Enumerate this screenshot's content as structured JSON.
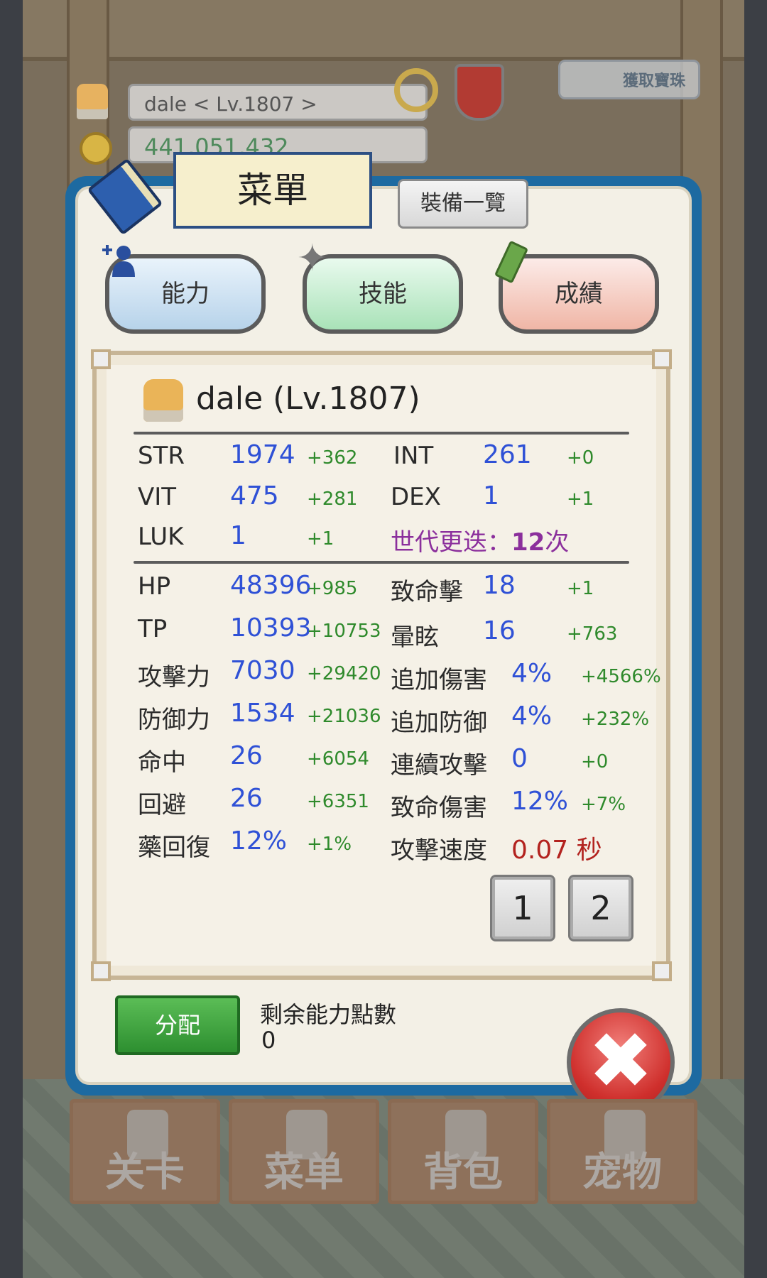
{
  "hud": {
    "name_level": "dale    < Lv.1807 >",
    "gold": "441,051,432",
    "get_treasure": "獲取寶珠"
  },
  "menu": {
    "title": "菜單",
    "equipment_list": "裝備一覽"
  },
  "tabs": [
    {
      "label": "能力",
      "icon": "add-person-icon"
    },
    {
      "label": "技能",
      "icon": "sparkle-star-icon"
    },
    {
      "label": "成績",
      "icon": "scroll-icon"
    }
  ],
  "character": {
    "name": "dale (Lv.1807)"
  },
  "stats_left_top": [
    {
      "label": "STR",
      "value": "1974",
      "bonus": "+362"
    },
    {
      "label": "VIT",
      "value": "475",
      "bonus": "+281"
    },
    {
      "label": "LUK",
      "value": "1",
      "bonus": "+1"
    }
  ],
  "stats_right_top": [
    {
      "label": "INT",
      "value": "261",
      "bonus": "+0"
    },
    {
      "label": "DEX",
      "value": "1",
      "bonus": "+1"
    }
  ],
  "generation": {
    "label": "世代更迭：",
    "count": "12",
    "unit": "次"
  },
  "stats_left": [
    {
      "label": "HP",
      "value": "48396",
      "bonus": "+985"
    },
    {
      "label": "TP",
      "value": "10393",
      "bonus": "+10753"
    },
    {
      "label": "攻擊力",
      "value": "7030",
      "bonus": "+29420"
    },
    {
      "label": "防御力",
      "value": "1534",
      "bonus": "+21036"
    },
    {
      "label": "命中",
      "value": "26",
      "bonus": "+6054"
    },
    {
      "label": "回避",
      "value": "26",
      "bonus": "+6351"
    },
    {
      "label": "藥回復",
      "value": "12%",
      "bonus": "+1%"
    }
  ],
  "stats_right": [
    {
      "label": "致命擊",
      "value": "18",
      "bonus": "+1"
    },
    {
      "label": "暈眩",
      "value": "16",
      "bonus": "+763"
    },
    {
      "label": "追加傷害",
      "value": "4%",
      "bonus": "+4566%"
    },
    {
      "label": "追加防御",
      "value": "4%",
      "bonus": "+232%"
    },
    {
      "label": "連續攻擊",
      "value": "0",
      "bonus": "+0"
    },
    {
      "label": "致命傷害",
      "value": "12%",
      "bonus": "+7%"
    },
    {
      "label": "攻擊速度",
      "value": "0.07",
      "unit": "秒"
    }
  ],
  "pages": [
    "1",
    "2"
  ],
  "assign": {
    "label": "分配",
    "remaining_label": "剩余能力點數",
    "remaining_value": "0"
  },
  "close_icon": "✖",
  "bottom_nav": [
    "关卡",
    "菜单",
    "背包",
    "宠物"
  ]
}
